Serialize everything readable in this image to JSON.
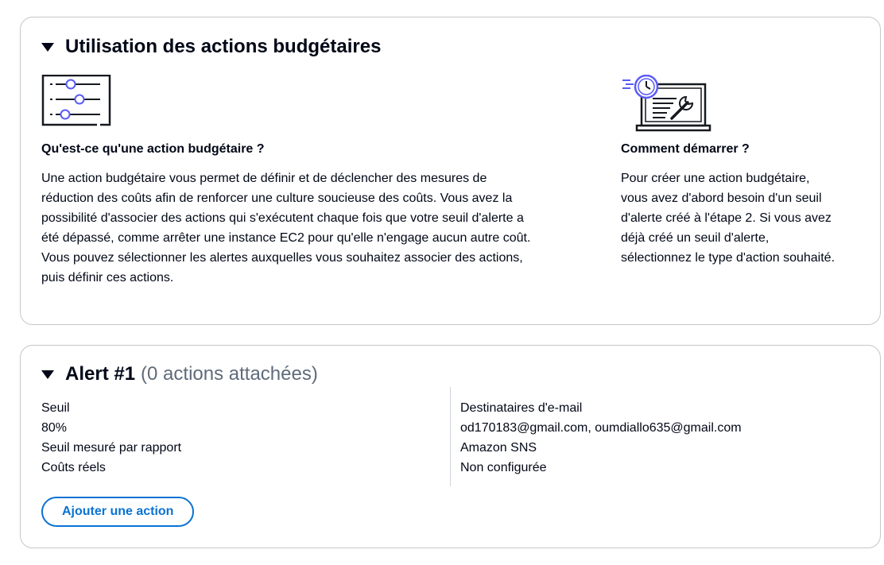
{
  "budget_actions_section": {
    "title": "Utilisation des actions budgétaires",
    "left": {
      "icon": "settings-sliders-icon",
      "heading": "Qu'est-ce qu'une action budgétaire ?",
      "lines": [
        "Une action budgétaire vous permet de définir et de déclencher des mesures de",
        "réduction des coûts afin de renforcer une culture soucieuse des coûts. Vous avez la",
        "possibilité d'associer des actions qui s'exécutent chaque fois que votre seuil d'alerte a",
        "été dépassé, comme arrêter une instance EC2 pour qu'elle n'engage aucun autre coût.",
        "Vous pouvez sélectionner les alertes auxquelles vous souhaitez associer des actions,",
        "puis définir ces actions."
      ]
    },
    "right": {
      "icon": "laptop-clock-wrench-icon",
      "heading": "Comment démarrer ?",
      "lines": [
        "Pour créer une action budgétaire,",
        "vous avez d'abord besoin d'un seuil",
        "d'alerte créé à l'étape 2. Si vous avez",
        "déjà créé un seuil d'alerte,",
        "sélectionnez le type d'action souhaité."
      ]
    }
  },
  "alert_section": {
    "title": "Alert #1",
    "subtitle": "(0 actions attachées)",
    "threshold_label": "Seuil",
    "threshold_value": "80%",
    "measured_label": "Seuil mesuré par rapport",
    "measured_value": "Coûts réels",
    "email_label": "Destinataires d'e-mail",
    "email_value": "od170183@gmail.com, oumdiallo635@gmail.com",
    "sns_label": "Amazon SNS",
    "sns_value": "Non configurée",
    "add_action_label": "Ajouter une action"
  },
  "colors": {
    "accent": "#0972d3",
    "illustration_accent": "#5b5bf7",
    "border": "#c6c6cd",
    "text": "#000716",
    "muted": "#5f6b7a"
  }
}
